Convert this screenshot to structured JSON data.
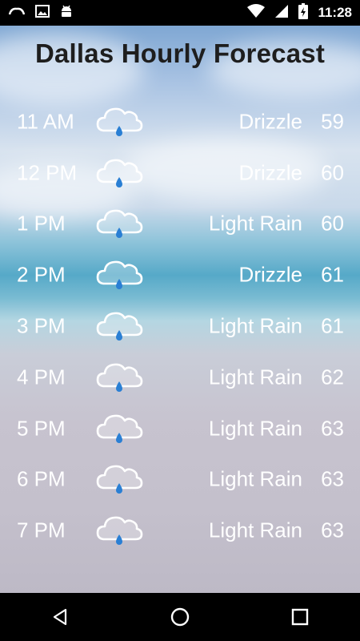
{
  "status_bar": {
    "time": "11:28",
    "left_icons": [
      "cloud-icon",
      "image-icon",
      "android-icon"
    ],
    "right_icons": [
      "wifi-icon",
      "signal-icon",
      "battery-charging-icon"
    ]
  },
  "title": "Dallas Hourly Forecast",
  "forecast": [
    {
      "time": "11 AM",
      "condition": "Drizzle",
      "temp": "59",
      "icon": "rain-cloud-icon"
    },
    {
      "time": "12 PM",
      "condition": "Drizzle",
      "temp": "60",
      "icon": "rain-cloud-icon"
    },
    {
      "time": "1 PM",
      "condition": "Light Rain",
      "temp": "60",
      "icon": "rain-cloud-icon"
    },
    {
      "time": "2 PM",
      "condition": "Drizzle",
      "temp": "61",
      "icon": "rain-cloud-icon"
    },
    {
      "time": "3 PM",
      "condition": "Light Rain",
      "temp": "61",
      "icon": "rain-cloud-icon"
    },
    {
      "time": "4 PM",
      "condition": "Light Rain",
      "temp": "62",
      "icon": "rain-cloud-icon"
    },
    {
      "time": "5 PM",
      "condition": "Light Rain",
      "temp": "63",
      "icon": "rain-cloud-icon"
    },
    {
      "time": "6 PM",
      "condition": "Light Rain",
      "temp": "63",
      "icon": "rain-cloud-icon"
    },
    {
      "time": "7 PM",
      "condition": "Light Rain",
      "temp": "63",
      "icon": "rain-cloud-icon"
    }
  ],
  "nav_bar": {
    "buttons": [
      "back-icon",
      "home-icon",
      "recents-icon"
    ]
  },
  "colors": {
    "text": "#ffffff",
    "title": "#1e1e1e",
    "raindrop": "#2a7fd4"
  }
}
